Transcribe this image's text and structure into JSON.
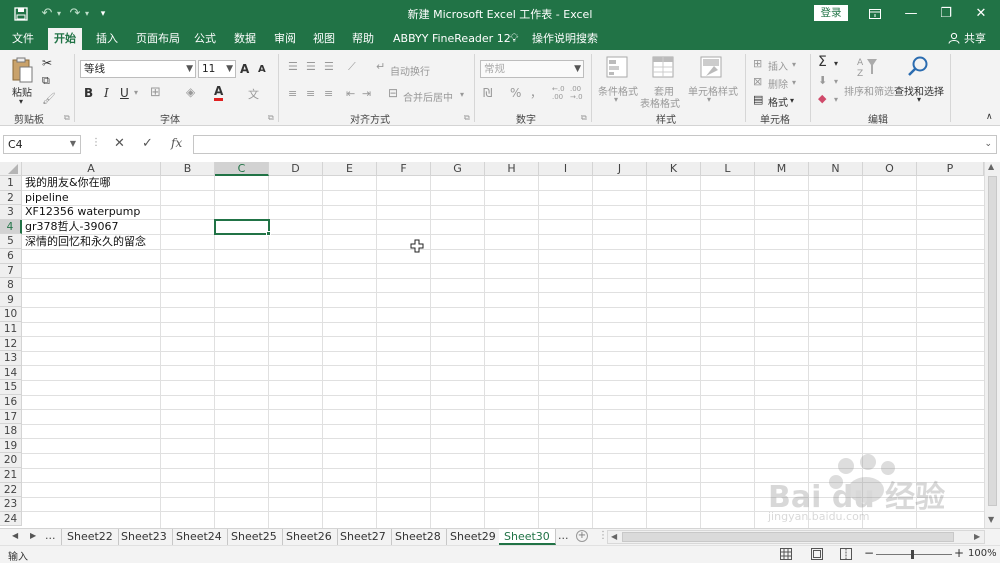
{
  "title_bar": {
    "title": "新建 Microsoft Excel 工作表  -  Excel",
    "login_button": "登录",
    "icons": [
      "save-icon",
      "undo-icon",
      "redo-icon",
      "customize-qat-icon",
      "ribbon-display-icon",
      "minimize-icon",
      "restore-icon",
      "close-icon"
    ]
  },
  "tabs": [
    {
      "label": "文件"
    },
    {
      "label": "开始"
    },
    {
      "label": "插入"
    },
    {
      "label": "页面布局"
    },
    {
      "label": "公式"
    },
    {
      "label": "数据"
    },
    {
      "label": "审阅"
    },
    {
      "label": "视图"
    },
    {
      "label": "帮助"
    },
    {
      "label": "ABBYY FineReader 12"
    },
    {
      "label": "操作说明搜索"
    }
  ],
  "share_label": "共享",
  "ribbon": {
    "clipboard": {
      "group": "剪贴板",
      "paste": "粘贴"
    },
    "font": {
      "group": "字体",
      "font_name": "等线",
      "font_size": "11",
      "bold": "B",
      "italic": "I",
      "underline": "U",
      "grow": "A",
      "shrink": "A",
      "font_color": "A",
      "phonetic": "文"
    },
    "alignment": {
      "group": "对齐方式",
      "wrap": "自动换行",
      "merge": "合并后居中"
    },
    "number": {
      "group": "数字",
      "format": "常规",
      "percent": "%",
      "comma": "，",
      "inc_decimal": "←.0\n.00",
      "dec_decimal": ".00\n→.0"
    },
    "styles": {
      "group": "样式",
      "conditional": "条件格式",
      "table_format_1": "套用",
      "table_format_2": "表格格式",
      "cell_styles": "单元格样式"
    },
    "cells": {
      "group": "单元格",
      "insert": "插入",
      "delete": "删除",
      "format": "格式"
    },
    "editing": {
      "group": "编辑",
      "sort_filter": "排序和筛选",
      "find_select": "查找和选择"
    }
  },
  "formula_bar": {
    "name_box": "C4",
    "cancel": "✕",
    "enter": "✓",
    "fx": "fx",
    "formula": ""
  },
  "columns": [
    "A",
    "B",
    "C",
    "D",
    "E",
    "F",
    "G",
    "H",
    "I",
    "J",
    "K",
    "L",
    "M",
    "N",
    "O",
    "P"
  ],
  "rows": [
    "1",
    "2",
    "3",
    "4",
    "5",
    "6",
    "7",
    "8",
    "9",
    "10",
    "11",
    "12",
    "13",
    "14",
    "15",
    "16",
    "17",
    "18",
    "19",
    "20",
    "21",
    "22",
    "23",
    "24"
  ],
  "cells": [
    {
      "ref": "A1",
      "value": "我的朋友&你在哪"
    },
    {
      "ref": "A2",
      "value": "pipeline"
    },
    {
      "ref": "A3",
      "value": "XF12356 waterpump"
    },
    {
      "ref": "A4",
      "value": "gr378哲人-39067"
    },
    {
      "ref": "A5",
      "value": "深情的回忆和永久的留念"
    }
  ],
  "selected_cell": "C4",
  "sheets": [
    "Sheet22",
    "Sheet23",
    "Sheet24",
    "Sheet25",
    "Sheet26",
    "Sheet27",
    "Sheet28",
    "Sheet29",
    "Sheet30"
  ],
  "active_sheet": "Sheet30",
  "sheet_nav": {
    "prev": "◀",
    "next": "▶",
    "more_left": "...",
    "more_right": "..."
  },
  "status": {
    "mode": "输入",
    "zoom": "100%",
    "zoom_minus": "−",
    "zoom_plus": "+"
  },
  "watermark": {
    "brand": "Bai du 经验",
    "url": "jingyan.baidu.com"
  },
  "colors": {
    "excel_green": "#217346",
    "ribbon_bg": "#f3f3f3"
  }
}
